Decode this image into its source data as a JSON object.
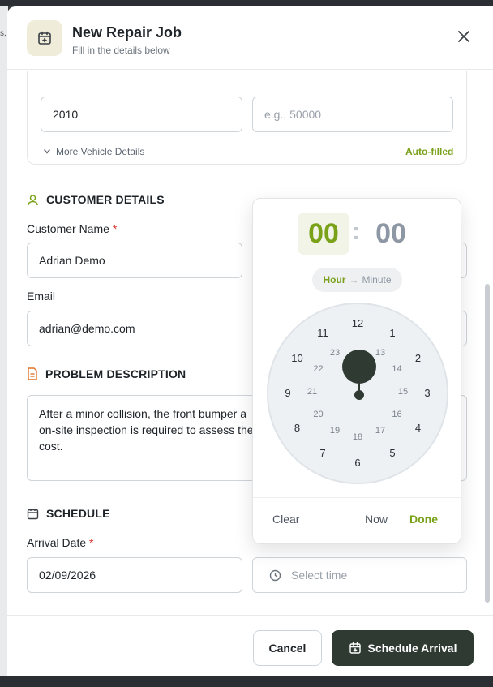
{
  "backdrop": {
    "fragment": "s,"
  },
  "header": {
    "title": "New Repair Job",
    "subtitle": "Fill in the details below"
  },
  "vehicle": {
    "year_value": "2010",
    "mileage_placeholder": "e.g., 50000",
    "more_details": "More Vehicle Details",
    "auto_filled": "Auto-filled"
  },
  "customer": {
    "section_title": "CUSTOMER DETAILS",
    "name_label": "Customer Name",
    "name_value": "Adrian Demo",
    "email_label": "Email",
    "email_value": "adrian@demo.com",
    "required_mark": "*"
  },
  "problem": {
    "section_title": "PROBLEM DESCRIPTION",
    "line1": "After a minor collision, the front bumper a",
    "line2": "on-site inspection is required to assess the",
    "line3": "cost."
  },
  "schedule": {
    "section_title": "SCHEDULE",
    "date_label": "Arrival Date",
    "date_value": "02/09/2026",
    "time_placeholder": "Select time"
  },
  "time_picker": {
    "hour": "00",
    "separator": ":",
    "minute": "00",
    "mode_active": "Hour",
    "mode_arrow": "→",
    "mode_next": "Minute",
    "outer_numbers": [
      "12",
      "1",
      "2",
      "3",
      "4",
      "5",
      "6",
      "7",
      "8",
      "9",
      "10",
      "11"
    ],
    "inner_numbers": [
      "13",
      "14",
      "15",
      "16",
      "17",
      "18",
      "19",
      "20",
      "21",
      "22",
      "23"
    ],
    "selected_hour": 0,
    "clear": "Clear",
    "now": "Now",
    "done": "Done"
  },
  "footer": {
    "cancel": "Cancel",
    "schedule": "Schedule Arrival"
  },
  "colors": {
    "accent": "#7aa11a",
    "primary": "#2f3a33",
    "required": "#d9352a",
    "problem_icon": "#e0742a",
    "customer_icon": "#7aa11a"
  }
}
